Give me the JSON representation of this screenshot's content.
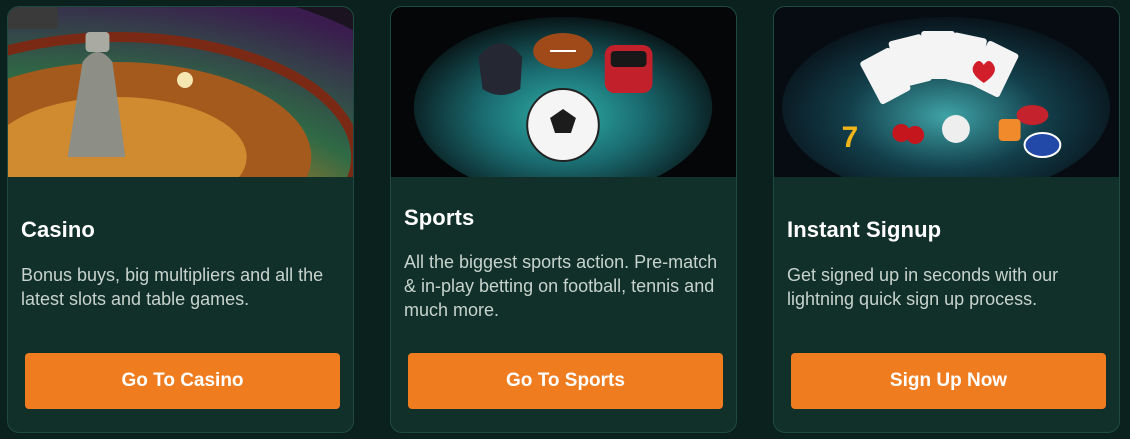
{
  "cards": [
    {
      "title": "Casino",
      "description": "Bonus buys, big multipliers and all the latest slots and table games.",
      "button_label": "Go To Casino",
      "image_icon": "roulette-wheel-icon"
    },
    {
      "title": "Sports",
      "description": "All the biggest sports action. Pre-match & in-play betting on football, tennis and much more.",
      "button_label": "Go To Sports",
      "image_icon": "sports-balls-icon"
    },
    {
      "title": "Instant Signup",
      "description": "Get signed up in seconds with our lightning quick sign up process.",
      "button_label": "Sign Up Now",
      "image_icon": "playing-cards-chips-icon"
    }
  ],
  "colors": {
    "page_background": "#0b211d",
    "card_background": "#12302a",
    "button": "#f07c20",
    "title_text": "#ffffff",
    "description_text": "#c7d2cc"
  }
}
